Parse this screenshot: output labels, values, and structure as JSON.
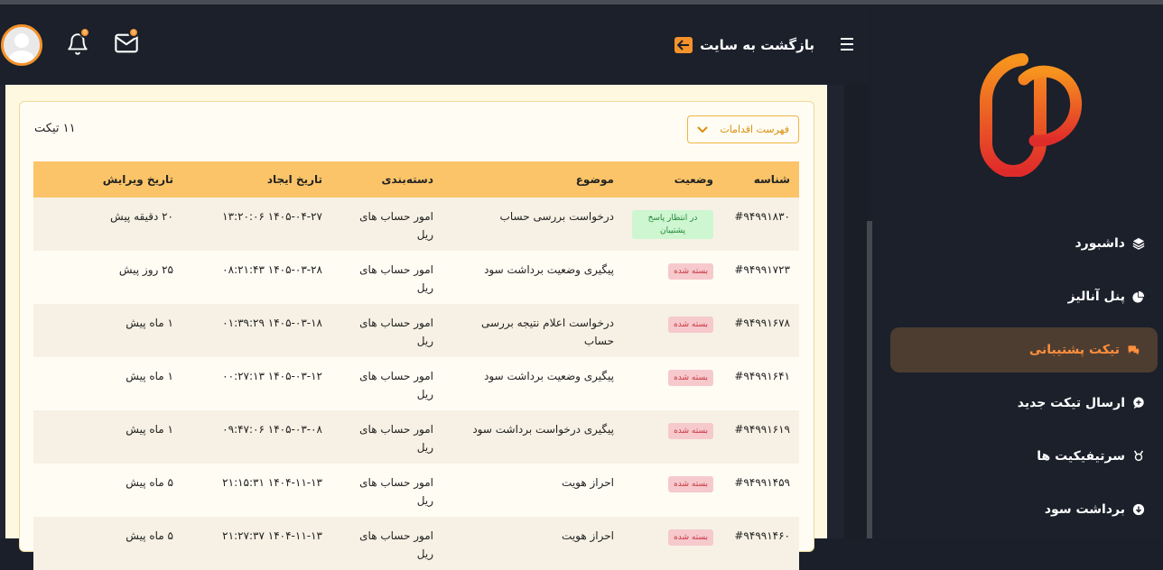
{
  "header": {
    "back_label": "بازگشت به سایت",
    "message_badge": "0",
    "notify_badge": "0"
  },
  "tickets": {
    "count_label": "۱۱ تیکت",
    "actions_label": "فهرست اقدامات",
    "columns": [
      "شناسه",
      "وضعیت",
      "موضوع",
      "دسته‌بندی",
      "تاریخ ایجاد",
      "تاریخ ویرایش"
    ],
    "rows": [
      {
        "id": "#۹۴۹۹۱۸۳۰",
        "status": "در انتظار پاسخ پشتیبان",
        "status_type": "open",
        "subject": "درخواست بررسی حساب",
        "category": "امور حساب های ریل",
        "created": "۱۴۰۵-۰۴-۲۷ ۱۳:۲۰:۰۶",
        "updated": "۲۰ دقیقه پیش"
      },
      {
        "id": "#۹۴۹۹۱۷۲۳",
        "status": "بسته شده",
        "status_type": "closed",
        "subject": "پیگیری وضعیت برداشت سود",
        "category": "امور حساب های ریل",
        "created": "۱۴۰۵-۰۳-۲۸ ۰۸:۲۱:۴۳",
        "updated": "۲۵ روز پیش"
      },
      {
        "id": "#۹۴۹۹۱۶۷۸",
        "status": "بسته شده",
        "status_type": "closed",
        "subject": "درخواست اعلام نتیجه بررسی حساب",
        "category": "امور حساب های ریل",
        "created": "۱۴۰۵-۰۳-۱۸ ۰۱:۳۹:۲۹",
        "updated": "۱ ماه پیش"
      },
      {
        "id": "#۹۴۹۹۱۶۴۱",
        "status": "بسته شده",
        "status_type": "closed",
        "subject": "پیگیری وضعیت برداشت سود",
        "category": "امور حساب های ریل",
        "created": "۱۴۰۵-۰۳-۱۲ ۰۰:۲۷:۱۳",
        "updated": "۱ ماه پیش"
      },
      {
        "id": "#۹۴۹۹۱۶۱۹",
        "status": "بسته شده",
        "status_type": "closed",
        "subject": "پیگیری درخواست برداشت سود",
        "category": "امور حساب های ریل",
        "created": "۱۴۰۵-۰۳-۰۸ ۰۹:۴۷:۰۶",
        "updated": "۱ ماه پیش"
      },
      {
        "id": "#۹۴۹۹۱۴۵۹",
        "status": "بسته شده",
        "status_type": "closed",
        "subject": "احراز هویت",
        "category": "امور حساب های ریل",
        "created": "۱۴۰۴-۱۱-۱۳ ۲۱:۱۵:۳۱",
        "updated": "۵ ماه پیش"
      },
      {
        "id": "#۹۴۹۹۱۴۶۰",
        "status": "بسته شده",
        "status_type": "closed",
        "subject": "احراز هویت",
        "category": "امور حساب های ریل",
        "created": "۱۴۰۴-۱۱-۱۳ ۲۱:۲۷:۳۷",
        "updated": "۵ ماه پیش"
      }
    ]
  },
  "sidebar": {
    "items": [
      {
        "label": "داشبورد",
        "icon": "layers-icon",
        "active": false
      },
      {
        "label": "پنل آنالیز",
        "icon": "pie-chart-icon",
        "active": false
      },
      {
        "label": "تیکت پشتیبانی",
        "icon": "chat-icon",
        "active": true
      },
      {
        "label": "ارسال تیکت جدید",
        "icon": "chat-plus-icon",
        "active": false
      },
      {
        "label": "سرتیفیکیت ها",
        "icon": "award-icon",
        "active": false
      },
      {
        "label": "برداشت سود",
        "icon": "download-circle-icon",
        "active": false
      }
    ]
  },
  "colors": {
    "accent": "#f5922a",
    "header_row": "#fbc468",
    "sidebar_active_bg": "#4d3d30",
    "dark_bg": "#1b202b"
  }
}
